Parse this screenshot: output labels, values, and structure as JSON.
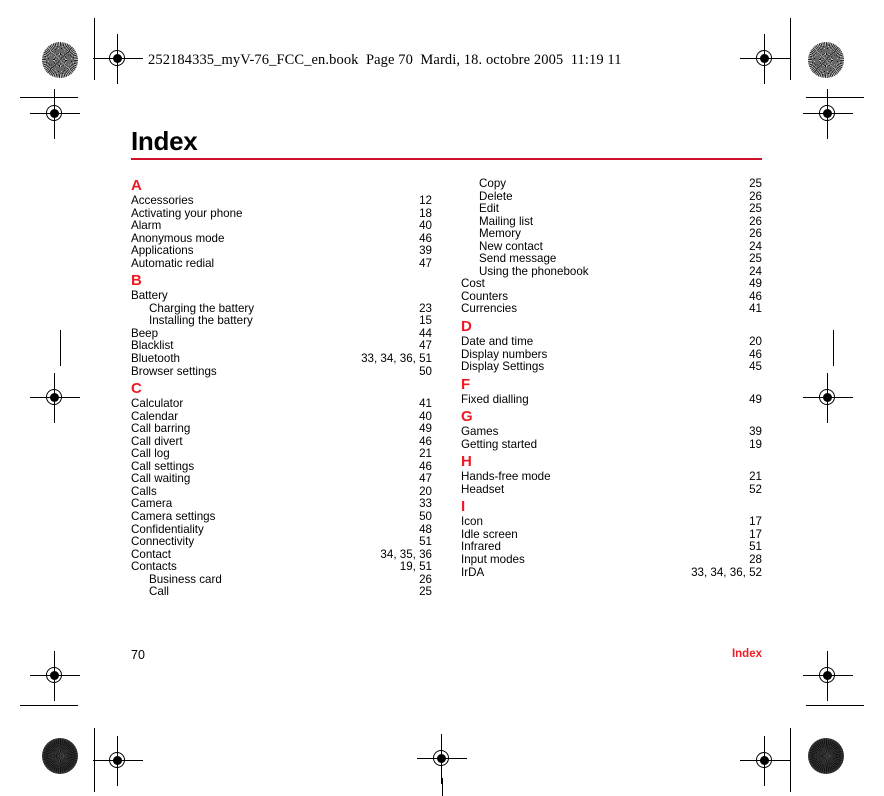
{
  "header": {
    "slug": "252184335_myV-76_FCC_en.book  Page 70  Mardi, 18. octobre 2005  11:19 11"
  },
  "title": "Index",
  "colors": {
    "accent_red": "#ED1C24",
    "rule_red": "#D0112B",
    "text_black": "#000000"
  },
  "footer": {
    "page_number": "70",
    "section_label": "Index"
  },
  "columns": [
    {
      "name": "left-column",
      "sections": [
        {
          "letter": "A",
          "entries": [
            {
              "label": "Accessories",
              "pages": "12",
              "sub": false
            },
            {
              "label": "Activating your phone",
              "pages": "18",
              "sub": false
            },
            {
              "label": "Alarm",
              "pages": "40",
              "sub": false
            },
            {
              "label": "Anonymous mode",
              "pages": "46",
              "sub": false
            },
            {
              "label": "Applications",
              "pages": "39",
              "sub": false
            },
            {
              "label": "Automatic redial",
              "pages": "47",
              "sub": false
            }
          ]
        },
        {
          "letter": "B",
          "entries": [
            {
              "label": "Battery",
              "pages": "",
              "sub": false
            },
            {
              "label": "Charging the battery",
              "pages": "23",
              "sub": true
            },
            {
              "label": "Installing the battery",
              "pages": "15",
              "sub": true
            },
            {
              "label": "Beep",
              "pages": "44",
              "sub": false
            },
            {
              "label": "Blacklist",
              "pages": "47",
              "sub": false
            },
            {
              "label": "Bluetooth",
              "pages": "33, 34, 36, 51",
              "sub": false
            },
            {
              "label": "Browser settings",
              "pages": "50",
              "sub": false
            }
          ]
        },
        {
          "letter": "C",
          "entries": [
            {
              "label": "Calculator",
              "pages": "41",
              "sub": false
            },
            {
              "label": "Calendar",
              "pages": "40",
              "sub": false
            },
            {
              "label": "Call barring",
              "pages": "49",
              "sub": false
            },
            {
              "label": "Call divert",
              "pages": "46",
              "sub": false
            },
            {
              "label": "Call log",
              "pages": "21",
              "sub": false
            },
            {
              "label": "Call settings",
              "pages": "46",
              "sub": false
            },
            {
              "label": "Call waiting",
              "pages": "47",
              "sub": false
            },
            {
              "label": "Calls",
              "pages": "20",
              "sub": false
            },
            {
              "label": "Camera",
              "pages": "33",
              "sub": false
            },
            {
              "label": "Camera settings",
              "pages": "50",
              "sub": false
            },
            {
              "label": "Confidentiality",
              "pages": "48",
              "sub": false
            },
            {
              "label": "Connectivity",
              "pages": "51",
              "sub": false
            },
            {
              "label": "Contact",
              "pages": "34, 35, 36",
              "sub": false
            },
            {
              "label": "Contacts",
              "pages": "19, 51",
              "sub": false
            },
            {
              "label": "Business card",
              "pages": "26",
              "sub": true
            },
            {
              "label": "Call",
              "pages": "25",
              "sub": true
            }
          ]
        }
      ]
    },
    {
      "name": "right-column",
      "sections": [
        {
          "letter": "",
          "entries": [
            {
              "label": "Copy",
              "pages": "25",
              "sub": true
            },
            {
              "label": "Delete",
              "pages": "26",
              "sub": true
            },
            {
              "label": "Edit",
              "pages": "25",
              "sub": true
            },
            {
              "label": "Mailing list",
              "pages": "26",
              "sub": true
            },
            {
              "label": "Memory",
              "pages": "26",
              "sub": true
            },
            {
              "label": "New contact",
              "pages": "24",
              "sub": true
            },
            {
              "label": "Send message",
              "pages": "25",
              "sub": true
            },
            {
              "label": "Using the phonebook",
              "pages": "24",
              "sub": true
            },
            {
              "label": "Cost",
              "pages": "49",
              "sub": false
            },
            {
              "label": "Counters",
              "pages": "46",
              "sub": false
            },
            {
              "label": "Currencies",
              "pages": "41",
              "sub": false
            }
          ]
        },
        {
          "letter": "D",
          "entries": [
            {
              "label": "Date and time",
              "pages": "20",
              "sub": false
            },
            {
              "label": "Display numbers",
              "pages": "46",
              "sub": false
            },
            {
              "label": "Display Settings",
              "pages": "45",
              "sub": false
            }
          ]
        },
        {
          "letter": "F",
          "entries": [
            {
              "label": "Fixed dialling",
              "pages": "49",
              "sub": false
            }
          ]
        },
        {
          "letter": "G",
          "entries": [
            {
              "label": "Games",
              "pages": "39",
              "sub": false
            },
            {
              "label": "Getting started",
              "pages": "19",
              "sub": false
            }
          ]
        },
        {
          "letter": "H",
          "entries": [
            {
              "label": "Hands-free mode",
              "pages": "21",
              "sub": false
            },
            {
              "label": "Headset",
              "pages": "52",
              "sub": false
            }
          ]
        },
        {
          "letter": "I",
          "entries": [
            {
              "label": "Icon",
              "pages": "17",
              "sub": false
            },
            {
              "label": "Idle screen",
              "pages": "17",
              "sub": false
            },
            {
              "label": "Infrared",
              "pages": "51",
              "sub": false
            },
            {
              "label": "Input modes",
              "pages": "28",
              "sub": false
            },
            {
              "label": "IrDA",
              "pages": "33, 34, 36, 52",
              "sub": false
            }
          ]
        }
      ]
    }
  ]
}
